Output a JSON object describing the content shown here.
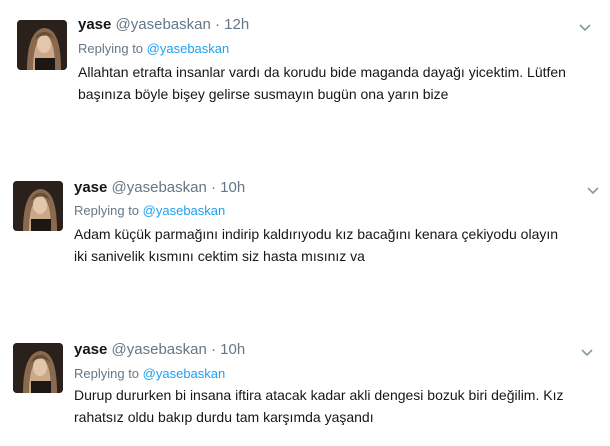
{
  "tweets": [
    {
      "name": "yase",
      "handle": "@yasebaskan",
      "separator": "·",
      "time": "12h",
      "replying_prefix": "Replying to",
      "replying_handle": "@yasebaskan",
      "line1": "Allahtan etrafta insanlar vardı da korudu bide maganda dayağı yicektim. Lütfen",
      "line2": "başınıza böyle bişey gelirse susmayın bugün ona yarın bize",
      "menu_icon": "chevron-down-icon"
    },
    {
      "name": "yase",
      "handle": "@yasebaskan",
      "separator": "·",
      "time": "10h",
      "replying_prefix": "Replying to",
      "replying_handle": "@yasebaskan",
      "line1": "Adam küçük parmağını indirip kaldırıyodu kız bacağını kenara çekiyodu olayın",
      "line2": "iki sanivelik kısmını cektim siz hasta mısınız va",
      "menu_icon": "chevron-down-icon"
    },
    {
      "name": "yase",
      "handle": "@yasebaskan",
      "separator": "·",
      "time": "10h",
      "replying_prefix": "Replying to",
      "replying_handle": "@yasebaskan",
      "line1": "Durup dururken bi insana iftira atacak kadar akli dengesi bozuk biri değilim. Kız",
      "line2": "rahatsız oldu bakıp durdu tam karşımda yaşandı",
      "menu_icon": "chevron-down-icon"
    }
  ],
  "colors": {
    "name": "#14171a",
    "meta": "#657786",
    "link": "#1da1f2",
    "text": "#14171a"
  }
}
